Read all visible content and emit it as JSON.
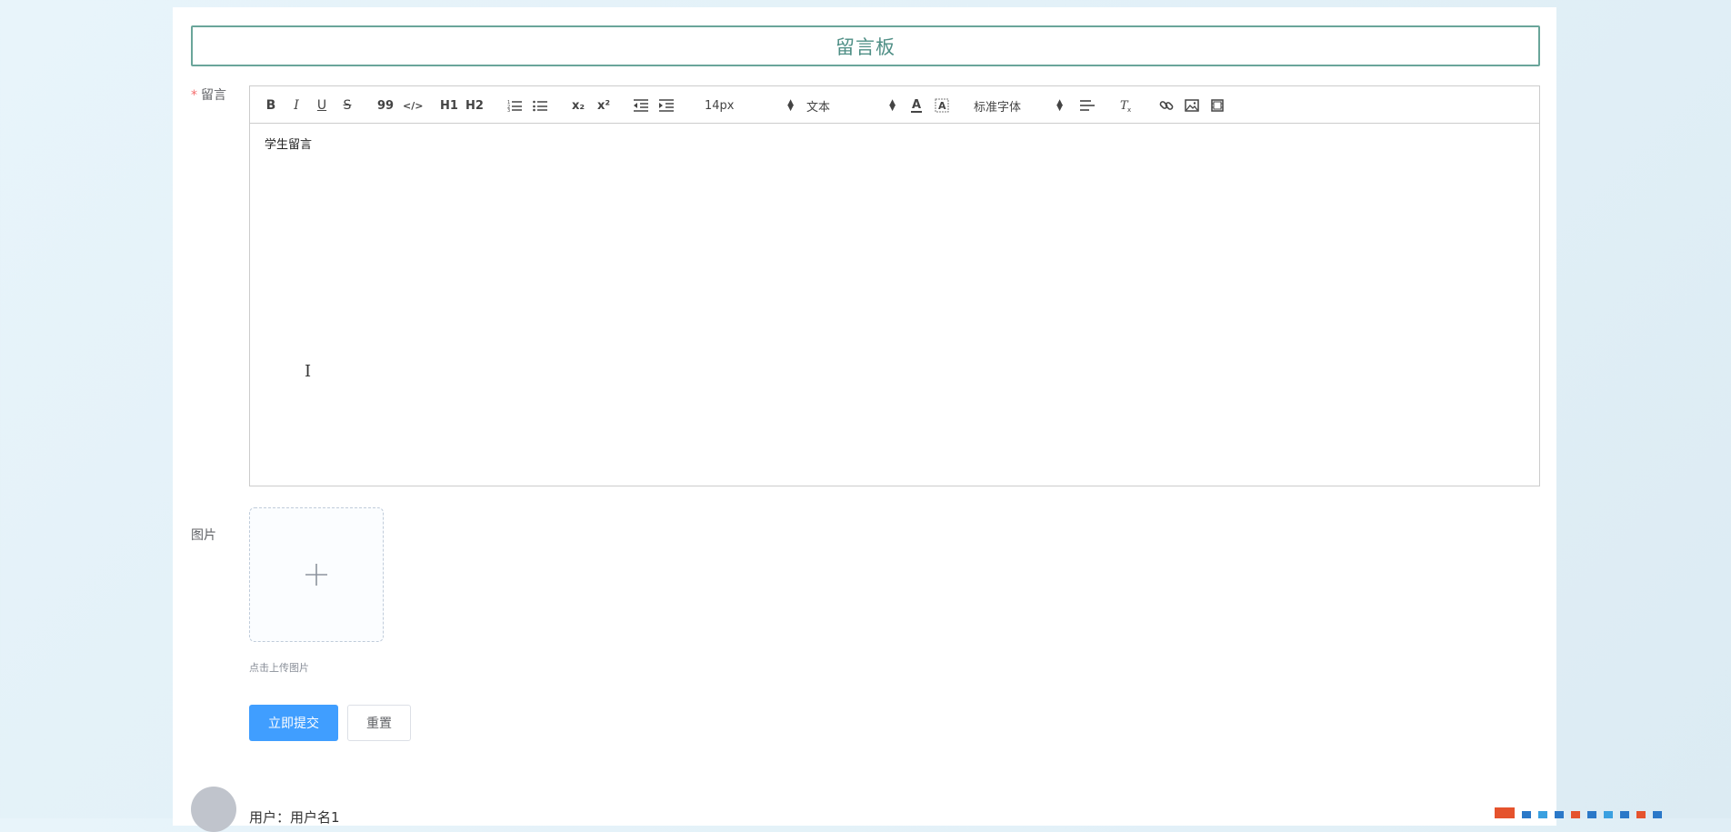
{
  "board": {
    "title": "留言板"
  },
  "form": {
    "message_label": "留言",
    "required_mark": "*",
    "image_label": "图片",
    "upload_tip": "点击上传图片",
    "submit_label": "立即提交",
    "reset_label": "重置"
  },
  "toolbar": {
    "bold": "B",
    "italic": "I",
    "underline": "U",
    "strike": "S",
    "blockquote": "99",
    "code": "</>",
    "h1": "H1",
    "h2": "H2",
    "subscript": "x₂",
    "superscript": "x²",
    "size_value": "14px",
    "header_value": "文本",
    "font_value": "标准字体",
    "color_letter": "A"
  },
  "editor": {
    "content": "学生留言"
  },
  "comments": [
    {
      "user_prefix": "用户：",
      "user_name": "用户名1"
    }
  ],
  "colors": {
    "primary": "#409eff",
    "title_border": "#6aa59a",
    "title_text": "#4f8f86",
    "required": "#f56c6c"
  }
}
